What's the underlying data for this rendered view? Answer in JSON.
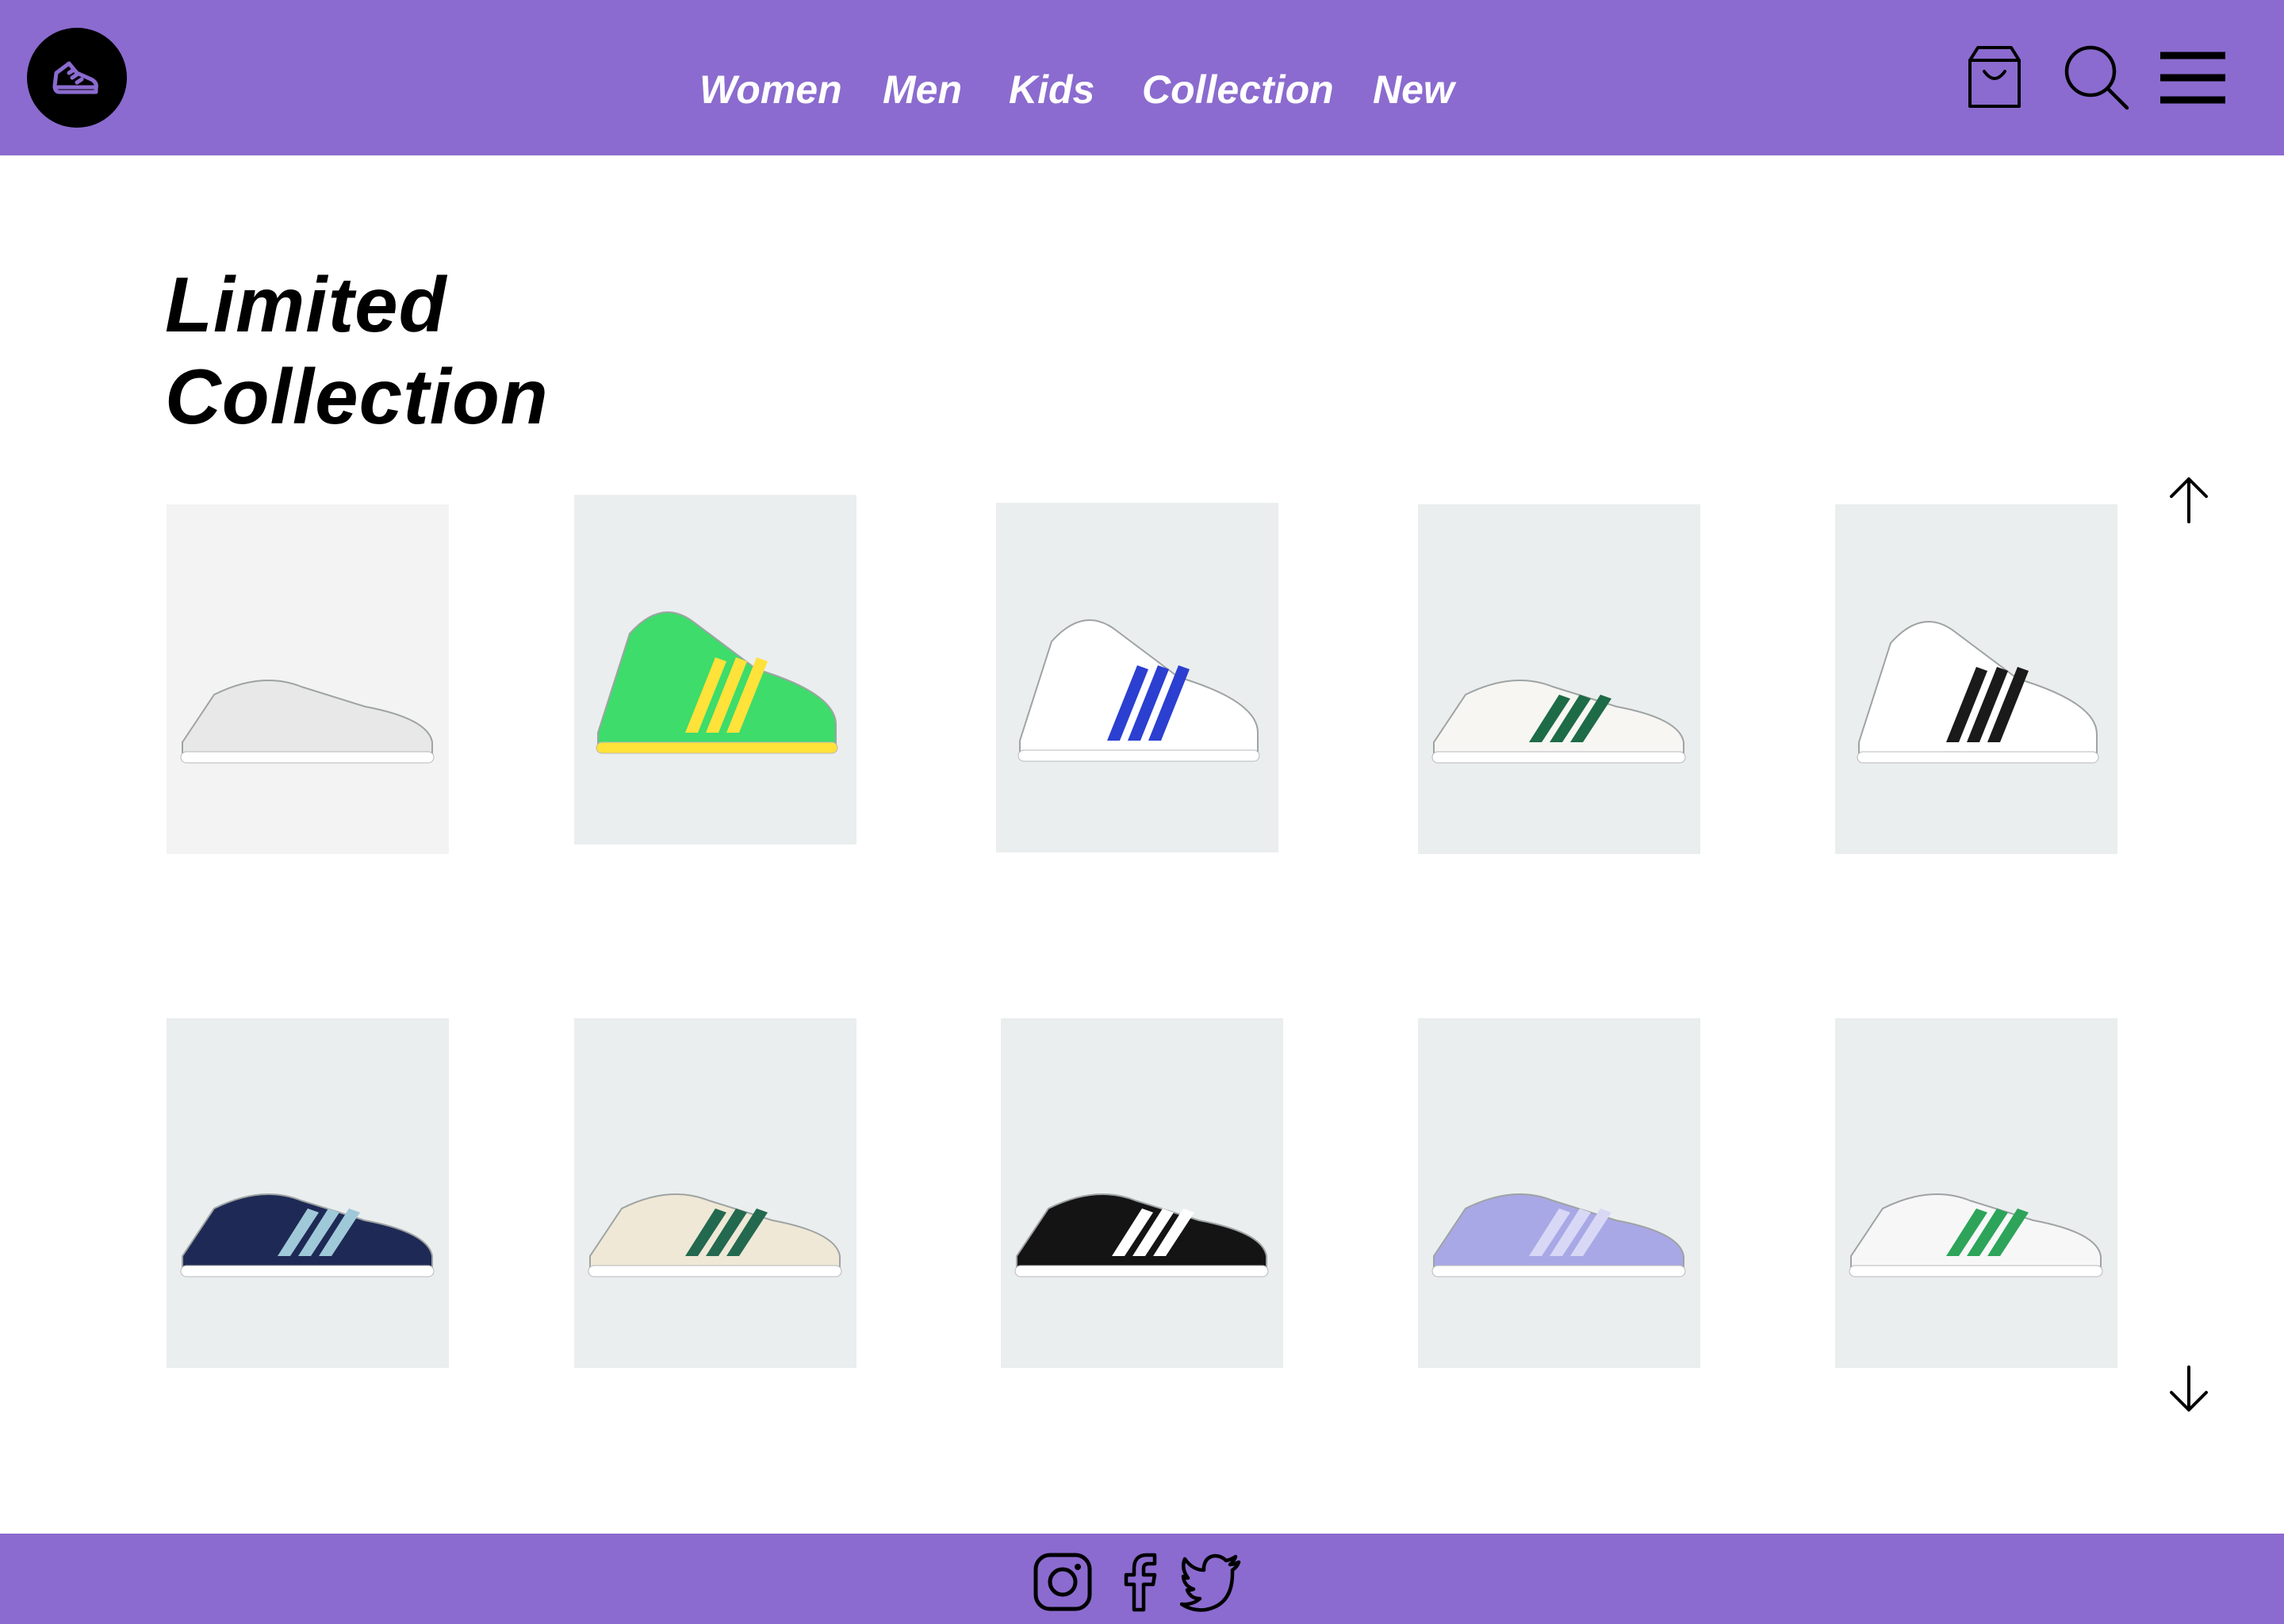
{
  "header": {
    "logo_icon": "sneaker-logo-icon",
    "nav": [
      "Women",
      "Men",
      "Kids",
      "Collection",
      "New"
    ],
    "icons": [
      "shopping-bag-icon",
      "search-icon",
      "hamburger-menu-icon"
    ]
  },
  "main": {
    "title_line1": "Limited",
    "title_line2": "Collection",
    "scroll_up_icon": "arrow-up-icon",
    "scroll_down_icon": "arrow-down-icon",
    "products": [
      {
        "name": "white-slide-sandal",
        "color": "#e7e8e7",
        "accent": "#cfd1d0"
      },
      {
        "name": "green-hiking-boot",
        "color": "#3ddc6b",
        "accent": "#ffe23a"
      },
      {
        "name": "white-blue-high-top",
        "color": "#ffffff",
        "accent": "#2b3fd1"
      },
      {
        "name": "white-green-retro-sneaker",
        "color": "#f7f6f2",
        "accent": "#1e6b47"
      },
      {
        "name": "white-black-high-top",
        "color": "#ffffff",
        "accent": "#1a1a1a"
      },
      {
        "name": "navy-running-shoe",
        "color": "#1e2a55",
        "accent": "#9fc9d8"
      },
      {
        "name": "cream-green-platform-sneaker",
        "color": "#efe8d6",
        "accent": "#23694f"
      },
      {
        "name": "black-shell-toe-sneaker",
        "color": "#141414",
        "accent": "#ffffff"
      },
      {
        "name": "lavender-platform-sneaker",
        "color": "#a9a8e6",
        "accent": "#d8d8f6"
      },
      {
        "name": "white-green-stripe-sneaker",
        "color": "#f7f7f7",
        "accent": "#2da45a"
      }
    ]
  },
  "footer": {
    "icons": [
      "instagram-icon",
      "facebook-icon",
      "twitter-icon"
    ]
  },
  "colors": {
    "brand_purple": "#8b6bcf",
    "card_background": "#ebeeee",
    "text": "#000000",
    "nav_text": "#ffffff"
  }
}
